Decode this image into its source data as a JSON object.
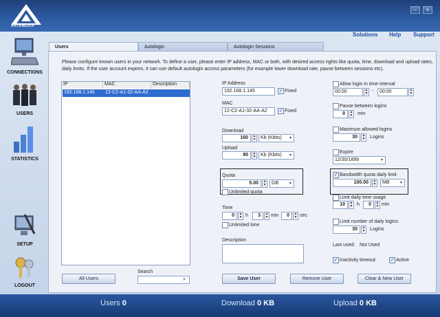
{
  "app": {
    "logo_text": "ANTAMEDIA",
    "min_icon": "minimize-icon",
    "close_icon": "close-icon"
  },
  "top_links": {
    "solutions": "Solutions",
    "help": "Help",
    "support": "Support"
  },
  "sidebar": {
    "items": [
      {
        "label": "CONNECTIONS",
        "icon": "computer-icon"
      },
      {
        "label": "USERS",
        "icon": "users-group-icon"
      },
      {
        "label": "STATISTICS",
        "icon": "bar-chart-icon"
      },
      {
        "label": "SETUP",
        "icon": "setup-monitor-icon"
      },
      {
        "label": "LOGOUT",
        "icon": "keys-icon"
      }
    ]
  },
  "tabs": {
    "users": "Users",
    "autologin": "Autologin",
    "autologin_sessions": "Autologin Sessions"
  },
  "intro": "Please configure known users in your network. To define a user, please enter IP address, MAC or both, with desired access rights like quota, time, download and upload rates, daily limits. If the user account expires, it can use default autologin access parameters (for example lower download rate, pause between sessions etc).",
  "list": {
    "columns": [
      "IP",
      "MAC",
      "Description"
    ],
    "rows": [
      {
        "ip": "192.168.1.145",
        "mac": "12-C2-A1-32-AA-A2",
        "description": ""
      }
    ],
    "all_users": "All Users",
    "search_label": "Search",
    "search_value": ""
  },
  "form": {
    "ip_label": "IP Address",
    "ip_value": "192.168.1.145",
    "ip_fixed": "Fixed",
    "mac_label": "MAC",
    "mac_value": "12-C2-A1-32-AA-A2",
    "mac_fixed": "Fixed",
    "download_label": "Download",
    "download_value": "160",
    "download_unit": "Kb (Kbits)",
    "upload_label": "Upload",
    "upload_value": "80",
    "upload_unit": "Kb (Kbits)",
    "quota_label": "Quota",
    "quota_value": "5.00",
    "quota_unit": "GB",
    "unlimited_quota": "Unlimited quota",
    "time_label": "Time",
    "time_h": "0",
    "time_h_unit": "h",
    "time_min": "3",
    "time_min_unit": "min",
    "time_sec": "0",
    "time_sec_unit": "sec",
    "unlimited_time": "Unlimited time",
    "description_label": "Description",
    "description_value": ""
  },
  "right": {
    "allow_login": "Allow login in time interval",
    "from": "00:00",
    "dash": "-",
    "to": "00:00",
    "pause": "Pause between logins",
    "pause_value": "0",
    "pause_unit": "min",
    "max_logins": "Maximum allowed logins",
    "max_logins_value": "30",
    "max_logins_unit": "Logins",
    "expire": "Expire",
    "expire_value": "12/30/1899",
    "bandwidth": "Bandwidth quota daily limit",
    "bandwidth_value": "100.00",
    "bandwidth_unit": "MB",
    "limit_time": "Limit daily time usage",
    "limit_h": "10",
    "limit_h_unit": "h",
    "limit_min": "0",
    "limit_min_unit": "min",
    "limit_logins": "Limit number of daily logins",
    "limit_logins_value": "30",
    "limit_logins_unit": "Logins",
    "last_used_label": "Last used:",
    "last_used_value": "Not Used",
    "inactivity": "Inactivity timeout",
    "active": "Active"
  },
  "buttons": {
    "save": "Save User",
    "remove": "Remove User",
    "clear": "Clear & New User"
  },
  "footer": {
    "users_label": "Users",
    "users_value": "0",
    "download_label": "Download",
    "download_value": "0 KB",
    "upload_label": "Upload",
    "upload_value": "0 KB"
  },
  "colors": {
    "accent": "#2c5aa0",
    "selection": "#2f6cd0"
  }
}
